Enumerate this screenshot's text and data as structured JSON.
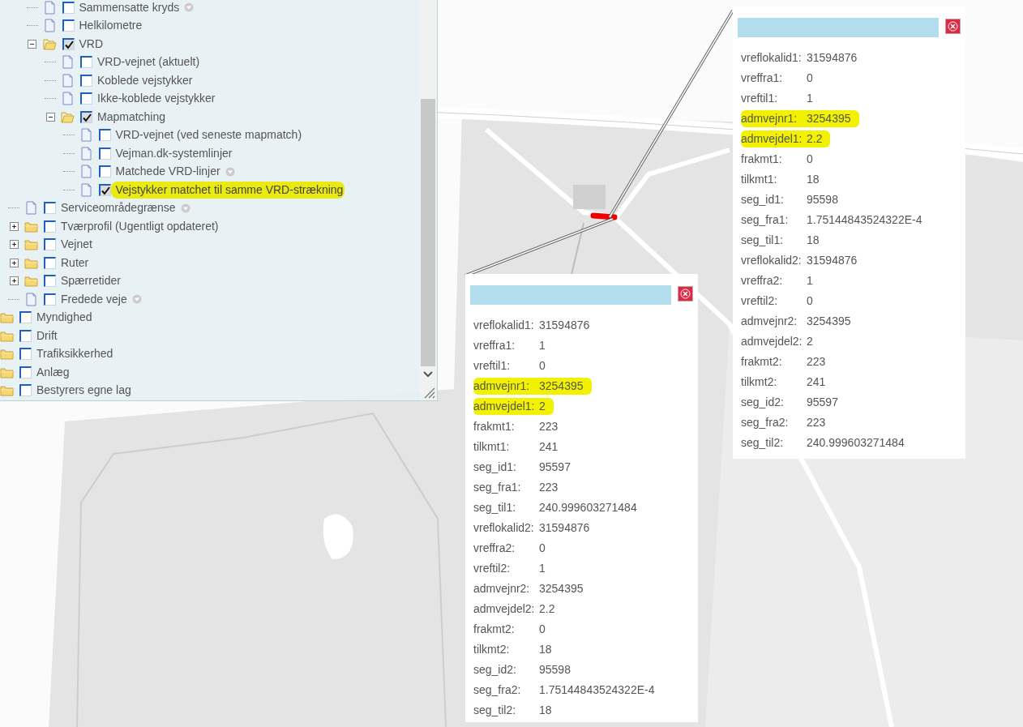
{
  "layer_tree": [
    {
      "children": [
        {
          "children": [
            {
              "label": "Sammensatte kryds",
              "kind": "layer",
              "checked": false,
              "info": true
            },
            {
              "label": "Helkilometre",
              "kind": "layer",
              "checked": false
            },
            {
              "label": "VRD",
              "kind": "folder",
              "checked": true,
              "expanded": true,
              "children": [
                {
                  "label": "VRD-vejnet (aktuelt)",
                  "kind": "layer",
                  "checked": false
                },
                {
                  "label": "Koblede vejstykker",
                  "kind": "layer",
                  "checked": false
                },
                {
                  "label": "Ikke-koblede vejstykker",
                  "kind": "layer",
                  "checked": false
                },
                {
                  "label": "Mapmatching",
                  "kind": "folder",
                  "checked": true,
                  "expanded": true,
                  "children": [
                    {
                      "label": "VRD-vejnet (ved seneste mapmatch)",
                      "kind": "layer",
                      "checked": false
                    },
                    {
                      "label": "Vejman.dk-systemlinjer",
                      "kind": "layer",
                      "checked": false
                    },
                    {
                      "label": "Matchede VRD-linjer",
                      "kind": "layer",
                      "checked": false,
                      "info": true
                    },
                    {
                      "label": "Vejstykker matchet til samme VRD-strækning",
                      "kind": "layer",
                      "checked": true,
                      "highlighted": true
                    }
                  ]
                }
              ]
            }
          ]
        },
        {
          "label": "Serviceområdegrænse",
          "kind": "layer",
          "checked": false,
          "info": true
        },
        {
          "label": "Tværprofil (Ugentligt opdateret)",
          "kind": "folder",
          "checked": false,
          "expanded": false
        },
        {
          "label": "Vejnet",
          "kind": "folder",
          "checked": false,
          "expanded": false
        },
        {
          "label": "Ruter",
          "kind": "folder",
          "checked": false,
          "expanded": false
        },
        {
          "label": "Spærretider",
          "kind": "folder",
          "checked": false,
          "expanded": false
        },
        {
          "label": "Fredede veje",
          "kind": "layer",
          "checked": false,
          "info": true
        }
      ]
    },
    {
      "label": "Myndighed",
      "kind": "folder",
      "checked": false
    },
    {
      "label": "Drift",
      "kind": "folder",
      "checked": false
    },
    {
      "label": "Trafiksikkerhed",
      "kind": "folder",
      "checked": false
    },
    {
      "label": "Anlæg",
      "kind": "folder",
      "checked": false
    },
    {
      "label": "Bestyrers egne lag",
      "kind": "folder",
      "checked": false
    }
  ],
  "popups": [
    {
      "rows": [
        {
          "label": "vreflokalid1:",
          "value": "31594876",
          "highlighted": false
        },
        {
          "label": "vreffra1:",
          "value": "0",
          "highlighted": false
        },
        {
          "label": "vreftil1:",
          "value": "1",
          "highlighted": false
        },
        {
          "label": "admvejnr1:",
          "value": "3254395",
          "highlighted": true
        },
        {
          "label": "admvejdel1:",
          "value": "2.2",
          "highlighted": true
        },
        {
          "label": "frakmt1:",
          "value": "0",
          "highlighted": false
        },
        {
          "label": "tilkmt1:",
          "value": "18",
          "highlighted": false
        },
        {
          "label": "seg_id1:",
          "value": "95598",
          "highlighted": false
        },
        {
          "label": "seg_fra1:",
          "value": "1.75144843524322E-4",
          "highlighted": false
        },
        {
          "label": "seg_til1:",
          "value": "18",
          "highlighted": false
        },
        {
          "label": "vreflokalid2:",
          "value": "31594876",
          "highlighted": false
        },
        {
          "label": "vreffra2:",
          "value": "1",
          "highlighted": false
        },
        {
          "label": "vreftil2:",
          "value": "0",
          "highlighted": false
        },
        {
          "label": "admvejnr2:",
          "value": "3254395",
          "highlighted": false
        },
        {
          "label": "admvejdel2:",
          "value": "2",
          "highlighted": false
        },
        {
          "label": "frakmt2:",
          "value": "223",
          "highlighted": false
        },
        {
          "label": "tilkmt2:",
          "value": "241",
          "highlighted": false
        },
        {
          "label": "seg_id2:",
          "value": "95597",
          "highlighted": false
        },
        {
          "label": "seg_fra2:",
          "value": "223",
          "highlighted": false
        },
        {
          "label": "seg_til2:",
          "value": "240.999603271484",
          "highlighted": false
        }
      ]
    },
    {
      "rows": [
        {
          "label": "vreflokalid1:",
          "value": "31594876",
          "highlighted": false
        },
        {
          "label": "vreffra1:",
          "value": "1",
          "highlighted": false
        },
        {
          "label": "vreftil1:",
          "value": "0",
          "highlighted": false
        },
        {
          "label": "admvejnr1:",
          "value": "3254395",
          "highlighted": true
        },
        {
          "label": "admvejdel1:",
          "value": "2",
          "highlighted": true
        },
        {
          "label": "frakmt1:",
          "value": "223",
          "highlighted": false
        },
        {
          "label": "tilkmt1:",
          "value": "241",
          "highlighted": false
        },
        {
          "label": "seg_id1:",
          "value": "95597",
          "highlighted": false
        },
        {
          "label": "seg_fra1:",
          "value": "223",
          "highlighted": false
        },
        {
          "label": "seg_til1:",
          "value": "240.999603271484",
          "highlighted": false
        },
        {
          "label": "vreflokalid2:",
          "value": "31594876",
          "highlighted": false
        },
        {
          "label": "vreffra2:",
          "value": "0",
          "highlighted": false
        },
        {
          "label": "vreftil2:",
          "value": "1",
          "highlighted": false
        },
        {
          "label": "admvejnr2:",
          "value": "3254395",
          "highlighted": false
        },
        {
          "label": "admvejdel2:",
          "value": "2.2",
          "highlighted": false
        },
        {
          "label": "frakmt2:",
          "value": "0",
          "highlighted": false
        },
        {
          "label": "tilkmt2:",
          "value": "18",
          "highlighted": false
        },
        {
          "label": "seg_id2:",
          "value": "95598",
          "highlighted": false
        },
        {
          "label": "seg_fra2:",
          "value": "1.75144843524322E-4",
          "highlighted": false
        },
        {
          "label": "seg_til2:",
          "value": "18",
          "highlighted": false
        }
      ]
    }
  ]
}
